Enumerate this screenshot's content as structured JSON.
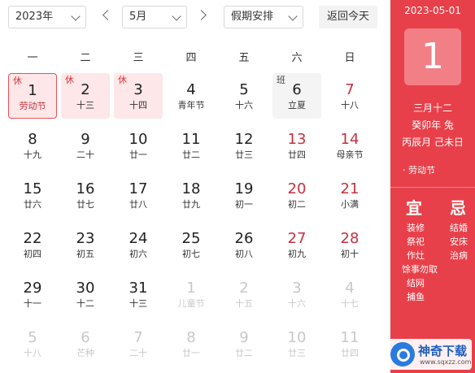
{
  "toolbar": {
    "year_value": "2023年",
    "month_value": "5月",
    "holiday_select": "假期安排",
    "today_label": "返回今天"
  },
  "weekdays": [
    "一",
    "二",
    "三",
    "四",
    "五",
    "六",
    "日"
  ],
  "rest_tag": "休",
  "work_tag": "班",
  "days": [
    {
      "num": "1",
      "sub": "劳动节",
      "state": "holiday today festival",
      "tag": "rest"
    },
    {
      "num": "2",
      "sub": "十三",
      "state": "holiday",
      "tag": "rest"
    },
    {
      "num": "3",
      "sub": "十四",
      "state": "holiday",
      "tag": "rest"
    },
    {
      "num": "4",
      "sub": "青年节",
      "state": ""
    },
    {
      "num": "5",
      "sub": "十六",
      "state": ""
    },
    {
      "num": "6",
      "sub": "立夏",
      "state": "workday",
      "tag": "work"
    },
    {
      "num": "7",
      "sub": "十八",
      "state": "weekend"
    },
    {
      "num": "8",
      "sub": "十九",
      "state": ""
    },
    {
      "num": "9",
      "sub": "二十",
      "state": ""
    },
    {
      "num": "10",
      "sub": "廿一",
      "state": ""
    },
    {
      "num": "11",
      "sub": "廿二",
      "state": ""
    },
    {
      "num": "12",
      "sub": "廿三",
      "state": ""
    },
    {
      "num": "13",
      "sub": "廿四",
      "state": "weekend"
    },
    {
      "num": "14",
      "sub": "母亲节",
      "state": "weekend"
    },
    {
      "num": "15",
      "sub": "廿六",
      "state": ""
    },
    {
      "num": "16",
      "sub": "廿七",
      "state": ""
    },
    {
      "num": "17",
      "sub": "廿八",
      "state": ""
    },
    {
      "num": "18",
      "sub": "廿九",
      "state": ""
    },
    {
      "num": "19",
      "sub": "初一",
      "state": ""
    },
    {
      "num": "20",
      "sub": "初二",
      "state": "weekend"
    },
    {
      "num": "21",
      "sub": "小满",
      "state": "weekend"
    },
    {
      "num": "22",
      "sub": "初四",
      "state": ""
    },
    {
      "num": "23",
      "sub": "初五",
      "state": ""
    },
    {
      "num": "24",
      "sub": "初六",
      "state": ""
    },
    {
      "num": "25",
      "sub": "初七",
      "state": ""
    },
    {
      "num": "26",
      "sub": "初八",
      "state": ""
    },
    {
      "num": "27",
      "sub": "初九",
      "state": "weekend"
    },
    {
      "num": "28",
      "sub": "初十",
      "state": "weekend"
    },
    {
      "num": "29",
      "sub": "十一",
      "state": ""
    },
    {
      "num": "30",
      "sub": "十二",
      "state": ""
    },
    {
      "num": "31",
      "sub": "十三",
      "state": ""
    },
    {
      "num": "1",
      "sub": "儿童节",
      "state": "other"
    },
    {
      "num": "2",
      "sub": "十五",
      "state": "other"
    },
    {
      "num": "3",
      "sub": "十六",
      "state": "other"
    },
    {
      "num": "4",
      "sub": "十七",
      "state": "other"
    },
    {
      "num": "5",
      "sub": "十八",
      "state": "other"
    },
    {
      "num": "6",
      "sub": "芒种",
      "state": "other"
    },
    {
      "num": "7",
      "sub": "二十",
      "state": "other"
    },
    {
      "num": "8",
      "sub": "廿一",
      "state": "other"
    },
    {
      "num": "9",
      "sub": "廿二",
      "state": "other"
    },
    {
      "num": "10",
      "sub": "廿三",
      "state": "other"
    },
    {
      "num": "11",
      "sub": "廿四",
      "state": "other"
    }
  ],
  "panel": {
    "date": "2023-05-01",
    "big_day": "1",
    "lunar_date": "三月十二",
    "ganzhi_year": "癸卯年 兔",
    "ganzhi_day": "丙辰月 己未日",
    "festival": "· 劳动节",
    "yi_label": "宜",
    "ji_label": "忌",
    "yi_items": [
      "装修",
      "祭祀",
      "作灶",
      "馀事勿取",
      "结网",
      "捕鱼"
    ],
    "ji_items": [
      "结婚",
      "安床",
      "治病"
    ]
  },
  "watermark": {
    "brand": "神奇下载",
    "url": "www.sqxzz.com"
  },
  "colors": {
    "accent": "#e8404a",
    "holiday_bg": "#fde7e8",
    "weekend_text": "#c6303e"
  }
}
